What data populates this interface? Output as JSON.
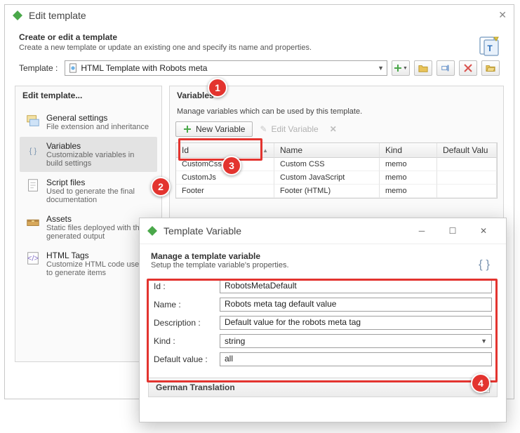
{
  "main_window": {
    "title": "Edit template",
    "section": {
      "title": "Create or edit a template",
      "desc": "Create a new template or update an existing one and specify its name and properties."
    },
    "template_label": "Template :",
    "template_value": "HTML Template with Robots meta",
    "left_panel_title": "Edit template...",
    "nav": [
      {
        "title": "General settings",
        "desc": "File extension and inheritance"
      },
      {
        "title": "Variables",
        "desc": "Customizable variables in build settings"
      },
      {
        "title": "Script files",
        "desc": "Used to generate the final documentation"
      },
      {
        "title": "Assets",
        "desc": "Static files deployed with the generated output"
      },
      {
        "title": "HTML Tags",
        "desc": "Customize HTML code used to generate items"
      }
    ],
    "right_panel_title": "Variables",
    "right_sub": "Manage variables which can be used by this template.",
    "new_variable": "New Variable",
    "edit_variable": "Edit Variable",
    "cols": {
      "id": "Id",
      "name": "Name",
      "kind": "Kind",
      "def": "Default Valu"
    },
    "rows": [
      {
        "id": "CustomCss",
        "name": "Custom CSS",
        "kind": "memo"
      },
      {
        "id": "CustomJs",
        "name": "Custom JavaScript",
        "kind": "memo"
      },
      {
        "id": "Footer",
        "name": "Footer (HTML)",
        "kind": "memo"
      }
    ]
  },
  "var_dialog": {
    "title": "Template Variable",
    "section": {
      "title": "Manage a template variable",
      "desc": "Setup the template variable's properties."
    },
    "labels": {
      "id": "Id :",
      "name": "Name :",
      "desc": "Description :",
      "kind": "Kind :",
      "def": "Default value :"
    },
    "values": {
      "id": "RobotsMetaDefault",
      "name": "Robots meta tag default value",
      "desc": "Default value for the robots meta tag",
      "kind": "string",
      "def": "all"
    },
    "accordion": "German Translation"
  },
  "callouts": {
    "c1": "1",
    "c2": "2",
    "c3": "3",
    "c4": "4"
  }
}
